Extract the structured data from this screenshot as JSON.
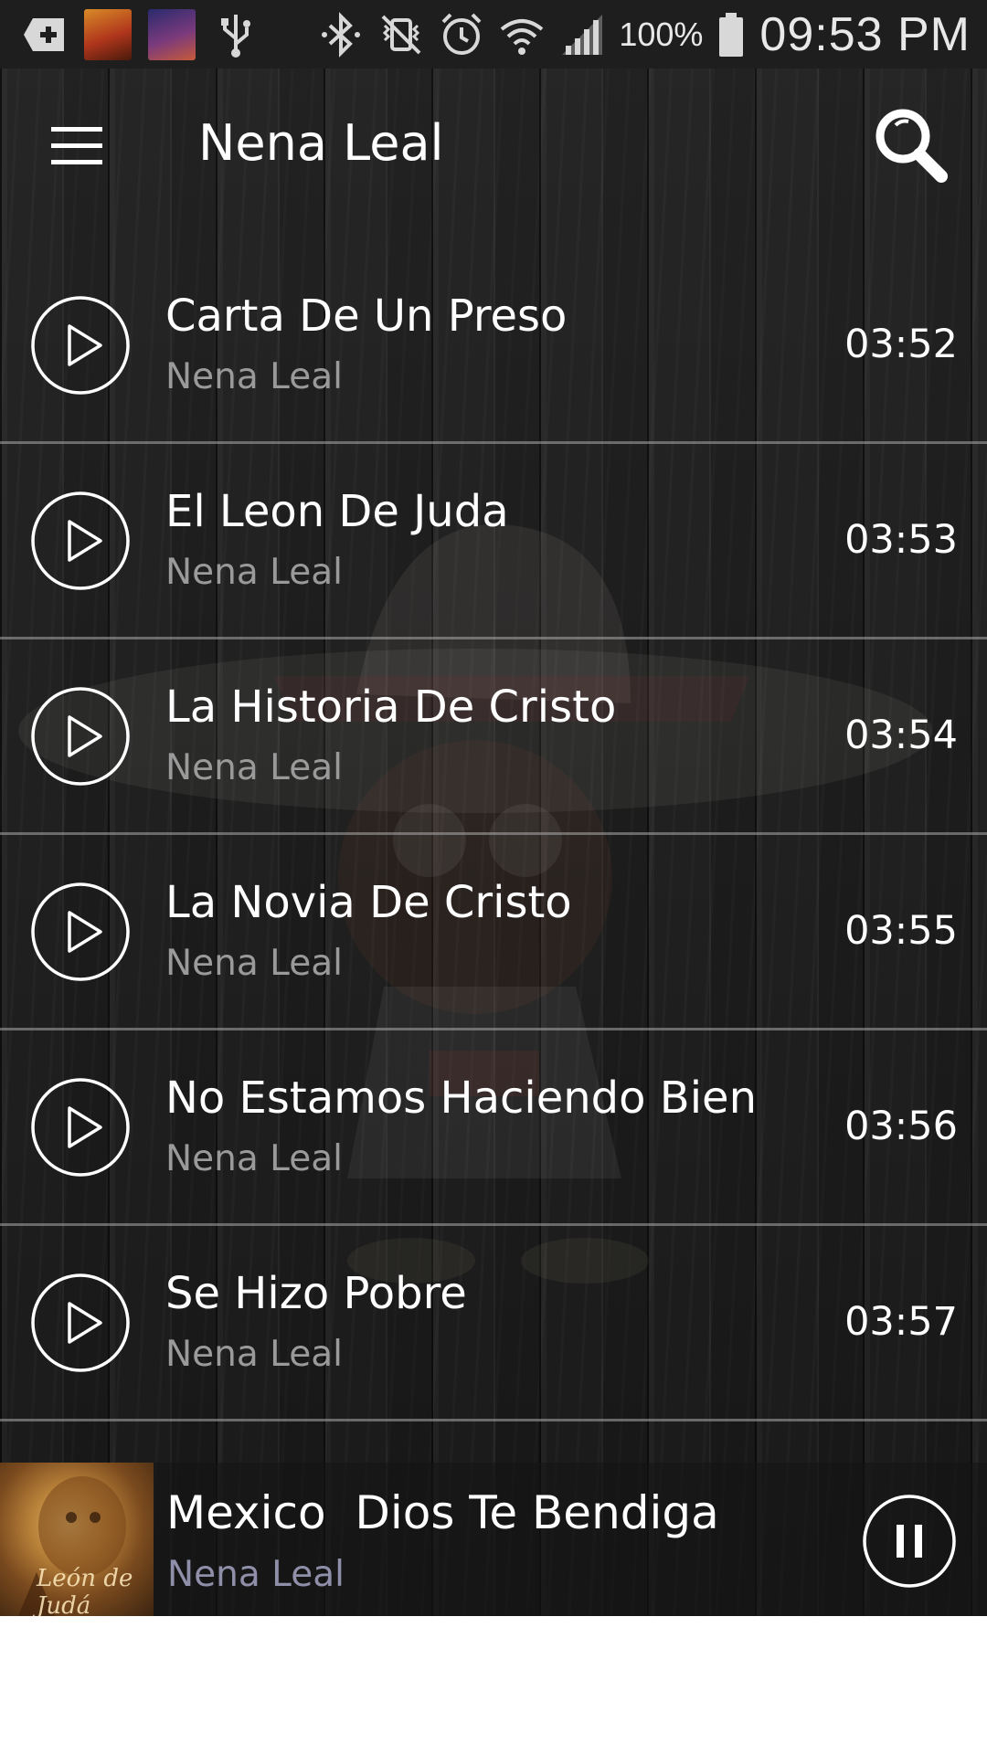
{
  "status_bar": {
    "icons_left": [
      "add-icon",
      "album-thumbnail",
      "album-thumbnail",
      "usb-icon"
    ],
    "icons_right": [
      "bluetooth-icon",
      "vibrate-mute-icon",
      "alarm-icon",
      "wifi-icon",
      "signal-icon",
      "battery-icon"
    ],
    "battery": "100%",
    "time": "09:53 PM"
  },
  "app_bar": {
    "title": "Nena Leal",
    "menu_icon": "hamburger-menu-icon",
    "search_icon": "search-icon"
  },
  "songs": [
    {
      "title": "Carta De Un Preso",
      "artist": "Nena Leal",
      "duration": "03:52"
    },
    {
      "title": "El Leon De Juda",
      "artist": "Nena Leal",
      "duration": "03:53"
    },
    {
      "title": "La Historia De Cristo",
      "artist": "Nena Leal",
      "duration": "03:54"
    },
    {
      "title": "La Novia De Cristo",
      "artist": "Nena Leal",
      "duration": "03:55"
    },
    {
      "title": "No Estamos Haciendo Bien",
      "artist": "Nena Leal",
      "duration": "03:56"
    },
    {
      "title": "Se Hizo Pobre",
      "artist": "Nena Leal",
      "duration": "03:57"
    }
  ],
  "now_playing": {
    "title": "Mexico  Dios Te Bendiga",
    "artist": "Nena Leal",
    "art_text": "León de Judá",
    "control_icon": "pause-icon"
  },
  "colors": {
    "background": "#1c1c1c",
    "text_primary": "#ffffff",
    "text_secondary": "#9a9a9a",
    "now_playing_artist": "#8f8faa"
  }
}
